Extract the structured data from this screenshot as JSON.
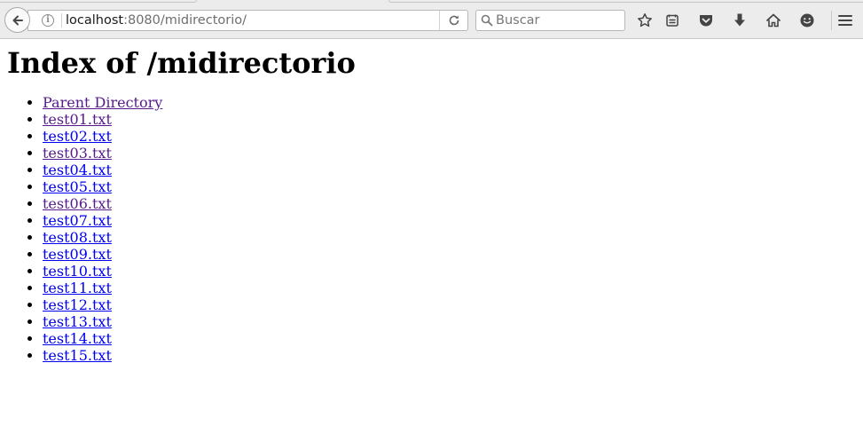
{
  "browser": {
    "url_host": "localhost",
    "url_path": ":8080/midirectorio/",
    "search_placeholder": "Buscar",
    "icons": [
      "back-arrow-icon",
      "site-info-icon",
      "reload-icon",
      "search-icon",
      "bookmark-star-icon",
      "reader-view-icon",
      "pocket-icon",
      "downloads-icon",
      "home-icon",
      "emoji-icon",
      "hamburger-menu-icon"
    ]
  },
  "page": {
    "title": "Index of /midirectorio",
    "entries": [
      {
        "label": "Parent Directory",
        "visited": true
      },
      {
        "label": "test01.txt",
        "visited": true
      },
      {
        "label": "test02.txt",
        "visited": false
      },
      {
        "label": "test03.txt",
        "visited": true
      },
      {
        "label": "test04.txt",
        "visited": false
      },
      {
        "label": "test05.txt",
        "visited": false
      },
      {
        "label": "test06.txt",
        "visited": true
      },
      {
        "label": "test07.txt",
        "visited": false
      },
      {
        "label": "test08.txt",
        "visited": false
      },
      {
        "label": "test09.txt",
        "visited": false
      },
      {
        "label": "test10.txt",
        "visited": false
      },
      {
        "label": "test11.txt",
        "visited": false
      },
      {
        "label": "test12.txt",
        "visited": false
      },
      {
        "label": "test13.txt",
        "visited": false
      },
      {
        "label": "test14.txt",
        "visited": false
      },
      {
        "label": "test15.txt",
        "visited": false
      }
    ]
  },
  "colors": {
    "link": "#0000ee",
    "visited_link": "#551a8b",
    "toolbar_bg": "#ececec"
  }
}
